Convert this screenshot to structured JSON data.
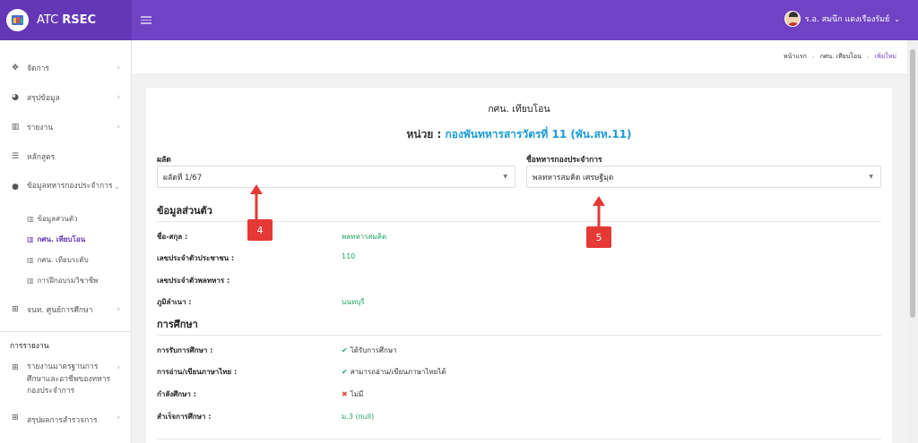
{
  "app": {
    "brand_prefix": "ATC",
    "brand_bold": "RSEC"
  },
  "user": {
    "name": "ร.อ. สมนึก แดงเรืองรัมย์"
  },
  "sidebar": {
    "items": [
      {
        "icon": "move-icon",
        "glyph": "✥",
        "label": "จัดการ"
      },
      {
        "icon": "pie-chart-icon",
        "glyph": "◕",
        "label": "สรุปข้อมูล"
      },
      {
        "icon": "bar-chart-icon",
        "glyph": "▥",
        "label": "รายงาน"
      },
      {
        "icon": "list-icon",
        "glyph": "☰",
        "label": "หลักสูตร"
      },
      {
        "icon": "users-icon",
        "glyph": "👥",
        "label": "ข้อมูลทหารกองประจำการ"
      }
    ],
    "subitems": [
      {
        "label": "ข้อมูลส่วนตัว"
      },
      {
        "label": "กศน. เทียบโอน"
      },
      {
        "label": "กศน. เทียบระดับ"
      },
      {
        "label": "การฝึกอบรมวิชาชีพ"
      }
    ],
    "center_item": {
      "label": "จนท. ศูนย์การศึกษา"
    },
    "section_heading": "การรายงาน",
    "report_item": {
      "label": "รายงานมาตรฐานการศึกษาและอาชีพของทหารกองประจำการ"
    },
    "last_item": {
      "label": "สรุปผลการสำรวจการ"
    }
  },
  "breadcrumb": {
    "home": "หน้าแรก",
    "parent": "กศน. เทียบโอน",
    "current": "เพิ่มใหม่"
  },
  "card": {
    "title": "กศน. เทียบโอน",
    "unit_label": "หน่วย :",
    "unit_name": "กองพันทหารสารวัตรที่ 11 (พัน.สห.11)",
    "batch_label": "ผลัด",
    "batch_value": "ผลัดที่ 1/67",
    "soldier_label": "ชื่อทหารกองประจำการ",
    "soldier_value": "พลทหารสมคิด เศรษฐีมุด"
  },
  "personal": {
    "heading": "ข้อมูลส่วนตัว",
    "rows": [
      {
        "label": "ชื่อ-สกุล :",
        "value": "พลทหารสมคิด"
      },
      {
        "label": "เลขประจำตัวประชาชน :",
        "value": "110"
      },
      {
        "label": "เลขประจำตัวพลทหาร :",
        "value": ""
      },
      {
        "label": "ภูมิลำเนา :",
        "value": "นนทบุรี"
      }
    ]
  },
  "education": {
    "heading": "การศึกษา",
    "rows": [
      {
        "label": "การรับการศึกษา :",
        "value": "ได้รับการศึกษา"
      },
      {
        "label": "การอ่าน/เขียนภาษาไทย :",
        "value": "สามารถอ่าน/เขียนภาษาไทยได้"
      },
      {
        "label": "กำลังศึกษา :",
        "value": "ไม่มี"
      },
      {
        "label": "สำเร็จการศึกษา :",
        "value": "ม.3 (null)"
      }
    ]
  },
  "annotations": [
    {
      "number": "4"
    },
    {
      "number": "5"
    }
  ],
  "colors": {
    "header": "#7043c4",
    "accent_link": "#1b9bd7",
    "value_green": "#1fa463",
    "annotation_red": "#e53935"
  }
}
